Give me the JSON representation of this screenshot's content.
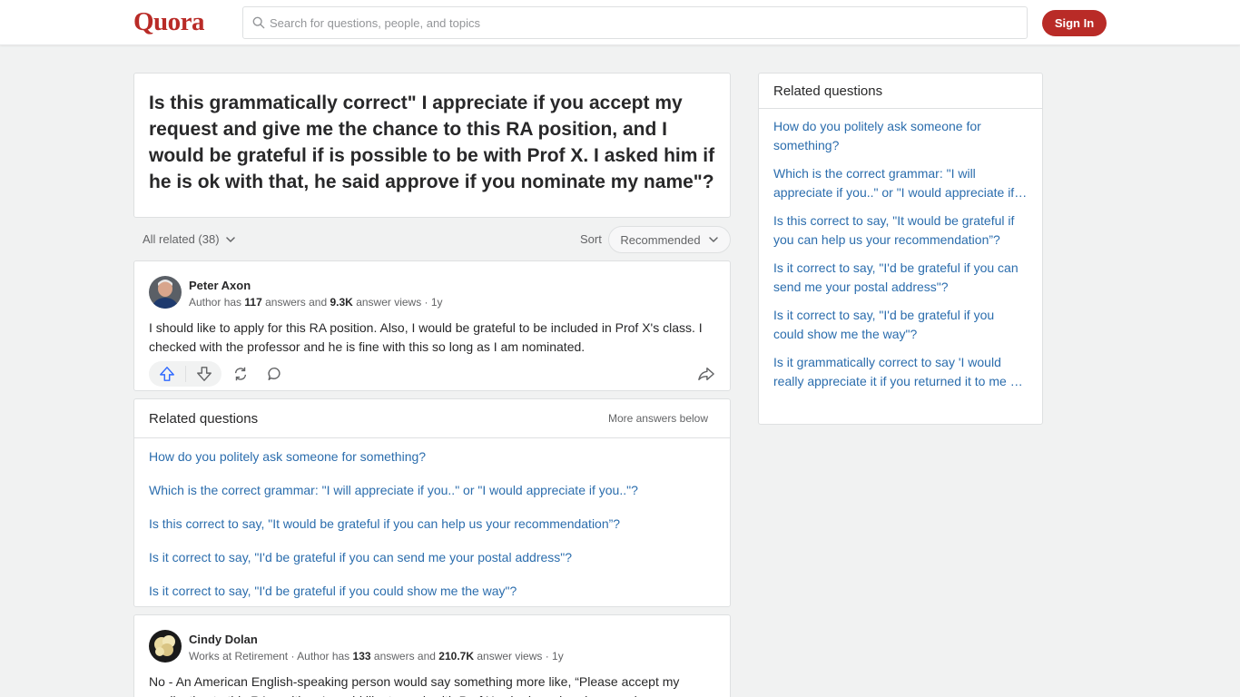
{
  "header": {
    "logo": "Quora",
    "search_placeholder": "Search for questions, people, and topics",
    "signin_label": "Sign In",
    "brand_color": "#b92b27"
  },
  "question": {
    "title": "Is this grammatically correct\" I appreciate if you accept my request and give me the chance to this RA position, and I would be grateful if is possible to be with Prof X. I asked him if he is ok with that, he said approve if you nominate my name\"?"
  },
  "filter": {
    "all_related": "All related (38)",
    "sort_label": "Sort",
    "sort_value": "Recommended"
  },
  "answers": [
    {
      "author": "Peter Axon",
      "meta_prefix": "Author has",
      "answers_count": "117",
      "meta_mid": "answers and",
      "views": "9.3K",
      "meta_suffix": "answer views · 1y",
      "text": "I should like to apply for this RA position. Also, I would be grateful to be included in Prof X's class. I checked with the professor and he is fine with this so long as I am nominated."
    },
    {
      "author": "Cindy Dolan",
      "meta_prefix": "Works at Retirement · Author has",
      "answers_count": "133",
      "meta_mid": "answers and",
      "views": "210.7K",
      "meta_suffix": "answer views · 1y",
      "text": "No - An American English-speaking person would say something more like, “Please accept my application to this RA position. I would like to work with Prof X, who has already agreed."
    }
  ],
  "related_mid": {
    "title": "Related questions",
    "more_below": "More answers below",
    "items": [
      "How do you politely ask someone for something?",
      "Which is the correct grammar: \"I will appreciate if you..\" or \"I would appreciate if you..\"?",
      "Is this correct to say, \"It would be grateful if you can help us your recommendation”?",
      "Is it correct to say, \"I'd be grateful if you can send me your postal address\"?",
      "Is it correct to say, \"I'd be grateful if you could show me the way\"?"
    ]
  },
  "related_side": {
    "title": "Related questions",
    "items": [
      "How do you politely ask someone for something?",
      "Which is the correct grammar: \"I will appreciate if you..\" or \"I would appreciate if you..\"?",
      "Is this correct to say, \"It would be grateful if you can help us your recommendation”?",
      "Is it correct to say, \"I'd be grateful if you can send me your postal address\"?",
      "Is it correct to say, \"I'd be grateful if you could show me the way\"?",
      "Is it grammatically correct to say 'I would really appreciate it if you returned it to me by Friday'?"
    ]
  },
  "icons": {
    "search": "search-icon",
    "upvote": "upvote-arrow-icon",
    "downvote": "downvote-arrow-icon",
    "share_repost": "repost-icon",
    "comment": "comment-bubble-icon",
    "share": "share-arrow-icon",
    "chevron": "chevron-down-icon"
  }
}
